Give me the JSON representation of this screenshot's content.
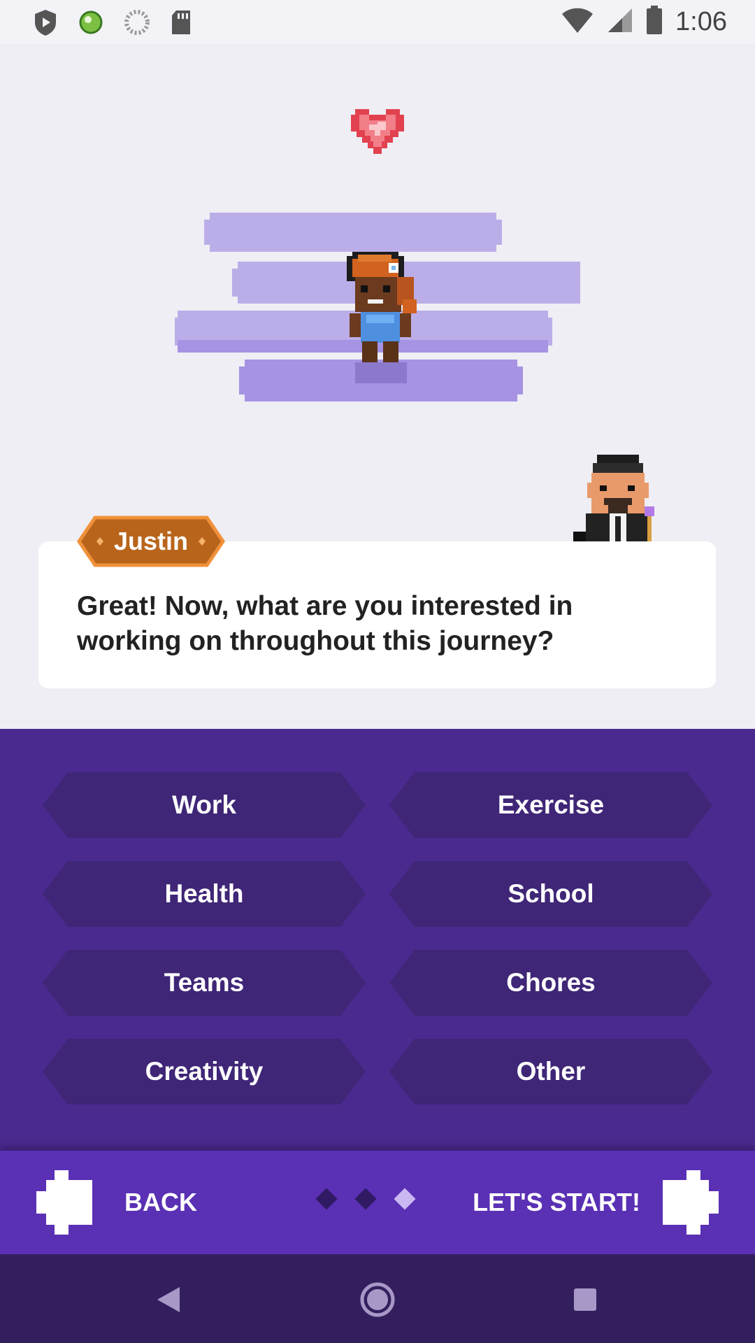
{
  "status_bar": {
    "time": "1:06",
    "icons": [
      "play-protect-icon",
      "app-notification-icon",
      "sync-icon",
      "sd-card-icon",
      "wifi-icon",
      "cell-signal-icon",
      "battery-icon"
    ]
  },
  "dialog": {
    "speaker": "Justin",
    "message": "Great! Now, what are you interested in working on throughout this journey?"
  },
  "options": [
    {
      "label": "Work"
    },
    {
      "label": "Exercise"
    },
    {
      "label": "Health"
    },
    {
      "label": "School"
    },
    {
      "label": "Teams"
    },
    {
      "label": "Chores"
    },
    {
      "label": "Creativity"
    },
    {
      "label": "Other"
    }
  ],
  "navigation": {
    "back_label": "BACK",
    "next_label": "LET'S START!",
    "page_indicator": {
      "total": 3,
      "current": 3
    }
  },
  "colors": {
    "background": "#efeef4",
    "panel": "#4b2a8f",
    "option": "#3f2677",
    "nav_bar": "#5a30b4",
    "system_nav": "#341f5e",
    "badge": "#b8651b",
    "badge_border": "#f0913a",
    "cloud": "#bbaee8"
  }
}
